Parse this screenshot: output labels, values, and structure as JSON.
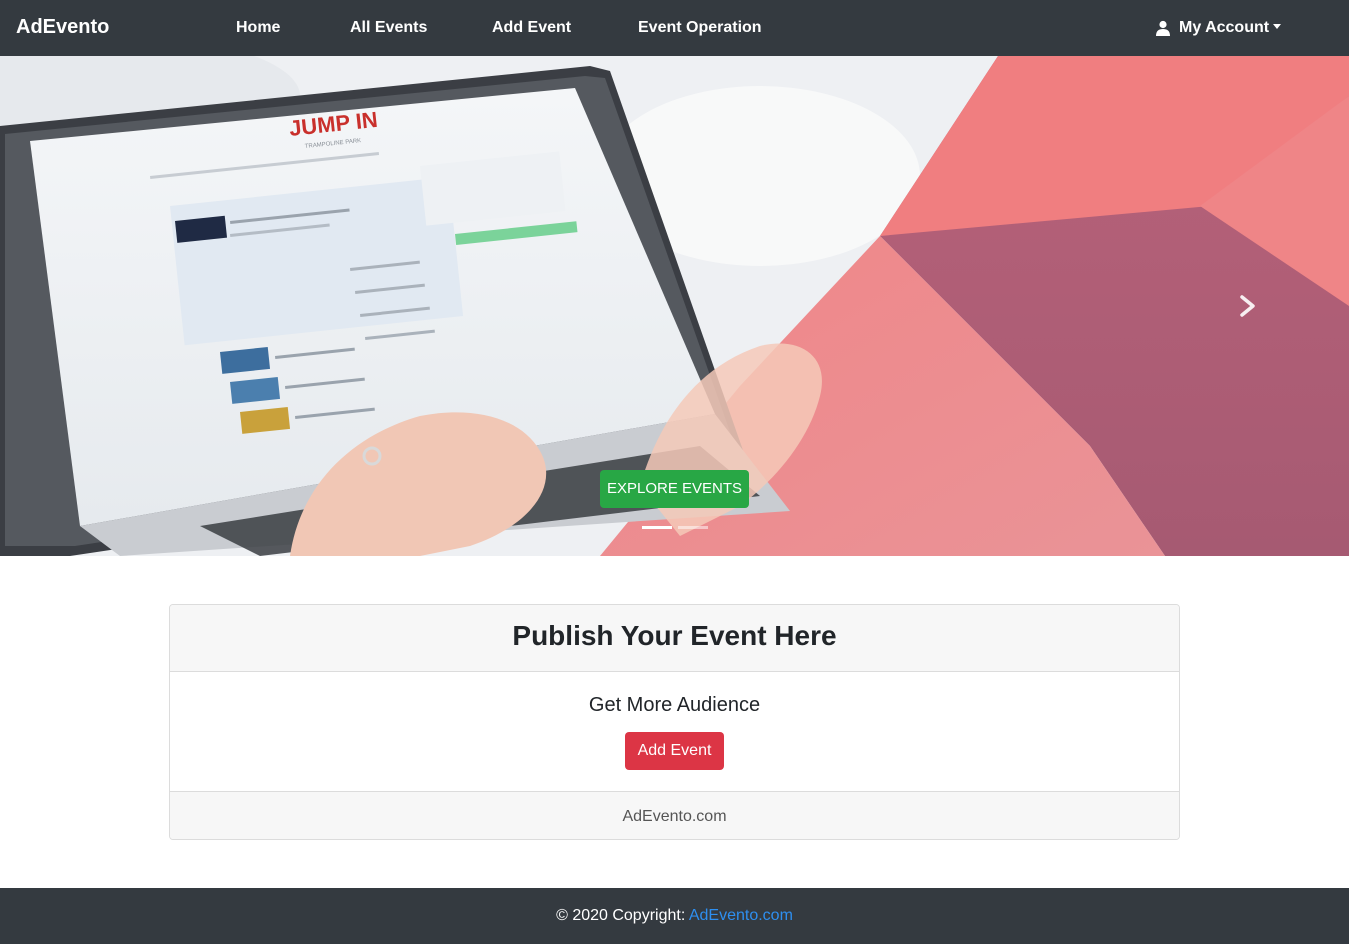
{
  "navbar": {
    "brand": "AdEvento",
    "links": [
      "Home",
      "All Events",
      "Add Event",
      "Event Operation"
    ],
    "account": "My Account",
    "account_icon": "user-icon",
    "background": "#343a40"
  },
  "carousel": {
    "image_text": {
      "logo": "JUMP IN",
      "logo_sub": "TRAMPOLINE PARK"
    },
    "cta_label": "EXPLORE EVENTS",
    "cta_color": "#28a745",
    "slide_count": 2,
    "active_slide": 1,
    "next_icon": "chevron-right-icon"
  },
  "card": {
    "title": "Publish Your Event Here",
    "subtitle": "Get More Audience",
    "button_label": "Add Event",
    "button_color": "#dc3545",
    "footer_text": "AdEvento.com"
  },
  "footer": {
    "copyright": "© 2020 Copyright: ",
    "link_text": "AdEvento.com",
    "link_color": "#2e8ff0"
  }
}
